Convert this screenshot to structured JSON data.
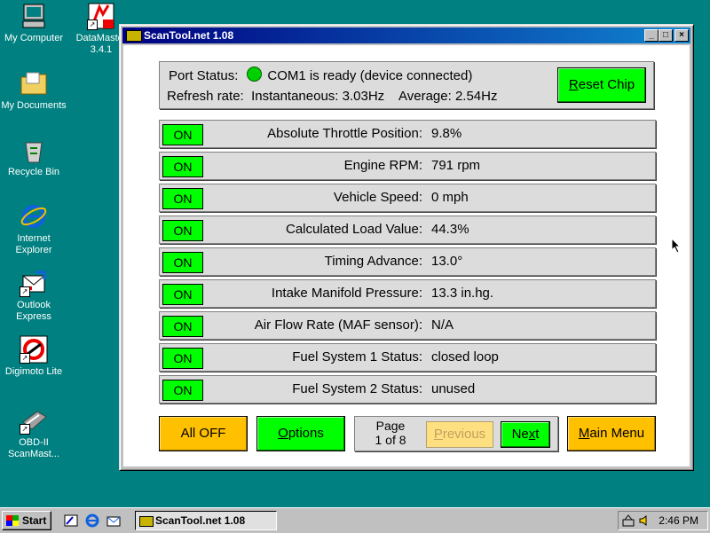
{
  "desktop": {
    "icons": [
      {
        "label": "My Computer",
        "icon": "my-computer-icon"
      },
      {
        "label": "DataMaster\n3.4.1",
        "icon": "datamaster-icon"
      },
      {
        "label": "My Documents",
        "icon": "folder-icon"
      },
      {
        "label": "Recycle Bin",
        "icon": "recycle-bin-icon"
      },
      {
        "label": "Internet\nExplorer",
        "icon": "internet-explorer-icon"
      },
      {
        "label": "Outlook\nExpress",
        "icon": "outlook-express-icon"
      },
      {
        "label": "Digimoto Lite",
        "icon": "digimoto-icon"
      },
      {
        "label": "OBD-II\nScanMast...",
        "icon": "obd-scanmaster-icon"
      }
    ]
  },
  "window": {
    "title": "ScanTool.net 1.08",
    "controls": {
      "minimize": "_",
      "maximize": "□",
      "close": "×"
    }
  },
  "status": {
    "port_label": "Port Status:",
    "port_value": "COM1 is ready (device connected)",
    "refresh_label": "Refresh rate:",
    "instantaneous": "Instantaneous: 3.03Hz",
    "average": "Average: 2.54Hz",
    "led_color": "#00d000",
    "reset_first": "R",
    "reset_rest": "eset Chip"
  },
  "pids": [
    {
      "toggle": "ON",
      "label": "Absolute Throttle Position:",
      "value": "9.8%"
    },
    {
      "toggle": "ON",
      "label": "Engine RPM:",
      "value": "791 rpm"
    },
    {
      "toggle": "ON",
      "label": "Vehicle Speed:",
      "value": "0 mph"
    },
    {
      "toggle": "ON",
      "label": "Calculated Load Value:",
      "value": "44.3%"
    },
    {
      "toggle": "ON",
      "label": "Timing Advance:",
      "value": "13.0°"
    },
    {
      "toggle": "ON",
      "label": "Intake Manifold Pressure:",
      "value": "13.3 in.hg."
    },
    {
      "toggle": "ON",
      "label": "Air Flow Rate (MAF sensor):",
      "value": "N/A"
    },
    {
      "toggle": "ON",
      "label": "Fuel System 1 Status:",
      "value": "closed loop"
    },
    {
      "toggle": "ON",
      "label": "Fuel System 2 Status:",
      "value": "unused"
    }
  ],
  "controls": {
    "all_off": "All OFF",
    "options_first": "O",
    "options_rest": "ptions",
    "page_label": "Page",
    "page_of": "1 of 8",
    "previous_first": "P",
    "previous_rest": "revious",
    "next_first": "Ne",
    "next_ul": "x",
    "next_rest": "t",
    "main_menu_first": "M",
    "main_menu_rest": "ain Menu"
  },
  "colors": {
    "desktop": "#008080",
    "on_green": "#00ff00",
    "button_yellow": "#ffc000",
    "panel_gray": "#dcdcdc",
    "title_blue": "#000080"
  },
  "taskbar": {
    "start_label": "Start",
    "task_label": "ScanTool.net 1.08",
    "clock": "2:46 PM"
  }
}
